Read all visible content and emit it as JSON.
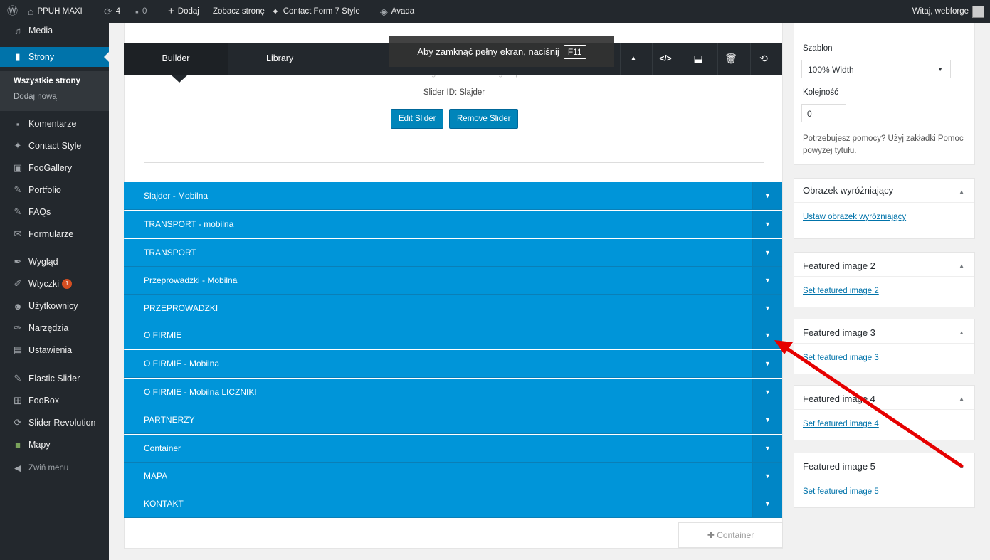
{
  "adminbar": {
    "site_name": "PPUH MAXI",
    "updates_count": "4",
    "comments_count": "0",
    "add_new": "Dodaj",
    "view_page": "Zobacz stronę",
    "cf7_style": "Contact Form 7 Style",
    "avada": "Avada",
    "greeting": "Witaj, webforge"
  },
  "sidebar": {
    "items": [
      {
        "label": "Media",
        "icon": "media-icon"
      },
      {
        "label": "Strony",
        "icon": "pages-icon"
      },
      {
        "label": "Komentarze",
        "icon": "comments-icon"
      },
      {
        "label": "Contact Style",
        "icon": "twitter-icon"
      },
      {
        "label": "FooGallery",
        "icon": "gallery-icon"
      },
      {
        "label": "Portfolio",
        "icon": "pin-icon"
      },
      {
        "label": "FAQs",
        "icon": "pin-icon"
      },
      {
        "label": "Formularze",
        "icon": "mail-icon"
      },
      {
        "label": "Wygląd",
        "icon": "brush-icon"
      },
      {
        "label": "Wtyczki",
        "icon": "plugin-icon",
        "badge": "1"
      },
      {
        "label": "Użytkownicy",
        "icon": "users-icon"
      },
      {
        "label": "Narzędzia",
        "icon": "wrench-icon"
      },
      {
        "label": "Ustawienia",
        "icon": "settings-icon"
      },
      {
        "label": "Elastic Slider",
        "icon": "pin-icon"
      },
      {
        "label": "FooBox",
        "icon": "grid-icon"
      },
      {
        "label": "Slider Revolution",
        "icon": "refresh-icon"
      },
      {
        "label": "Mapy",
        "icon": "map-icon"
      },
      {
        "label": "Zwiń menu",
        "icon": "collapse-icon"
      }
    ],
    "submenu": {
      "current": "Wszystkie strony",
      "add": "Dodaj nową"
    }
  },
  "builder": {
    "tab_builder": "Builder",
    "tab_library": "Library",
    "fullscreen_tip": "Aby zamknąć pełny ekran, naciśnij",
    "fullscreen_key": "F11",
    "slider_faded_text": "This slider is assigned via Fusion Page Options",
    "slider_id": "Slider ID: Slajder",
    "edit_slider": "Edit Slider",
    "remove_slider": "Remove Slider",
    "add_container": "Container",
    "containers": [
      "Slajder - Mobilna",
      "TRANSPORT - mobilna",
      "TRANSPORT",
      "Przeprowadzki - Mobilna",
      "PRZEPROWADZKI",
      "O FIRMIE",
      "O FIRMIE - Mobilna",
      "O FIRMIE - Mobilna LICZNIKI",
      "PARTNERZY",
      "Container",
      "MAPA",
      "KONTAKT"
    ]
  },
  "attributes": {
    "template_label": "Szablon",
    "template_value": "100% Width",
    "order_label": "Kolejność",
    "order_value": "0",
    "help_text": "Potrzebujesz pomocy? Użyj zakładki Pomoc powyżej tytułu."
  },
  "featured_boxes": [
    {
      "title": "Obrazek wyróżniający",
      "link": "Ustaw obrazek wyróżniający"
    },
    {
      "title": "Featured image 2",
      "link": "Set featured image 2"
    },
    {
      "title": "Featured image 3",
      "link": "Set featured image 3"
    },
    {
      "title": "Featured image 4",
      "link": "Set featured image 4"
    },
    {
      "title": "Featured image 5",
      "link": "Set featured image 5"
    }
  ],
  "colors": {
    "admin_dark": "#23282d",
    "wp_blue": "#0073aa",
    "container_blue": "#0095d9",
    "annotation_red": "#e60000"
  }
}
